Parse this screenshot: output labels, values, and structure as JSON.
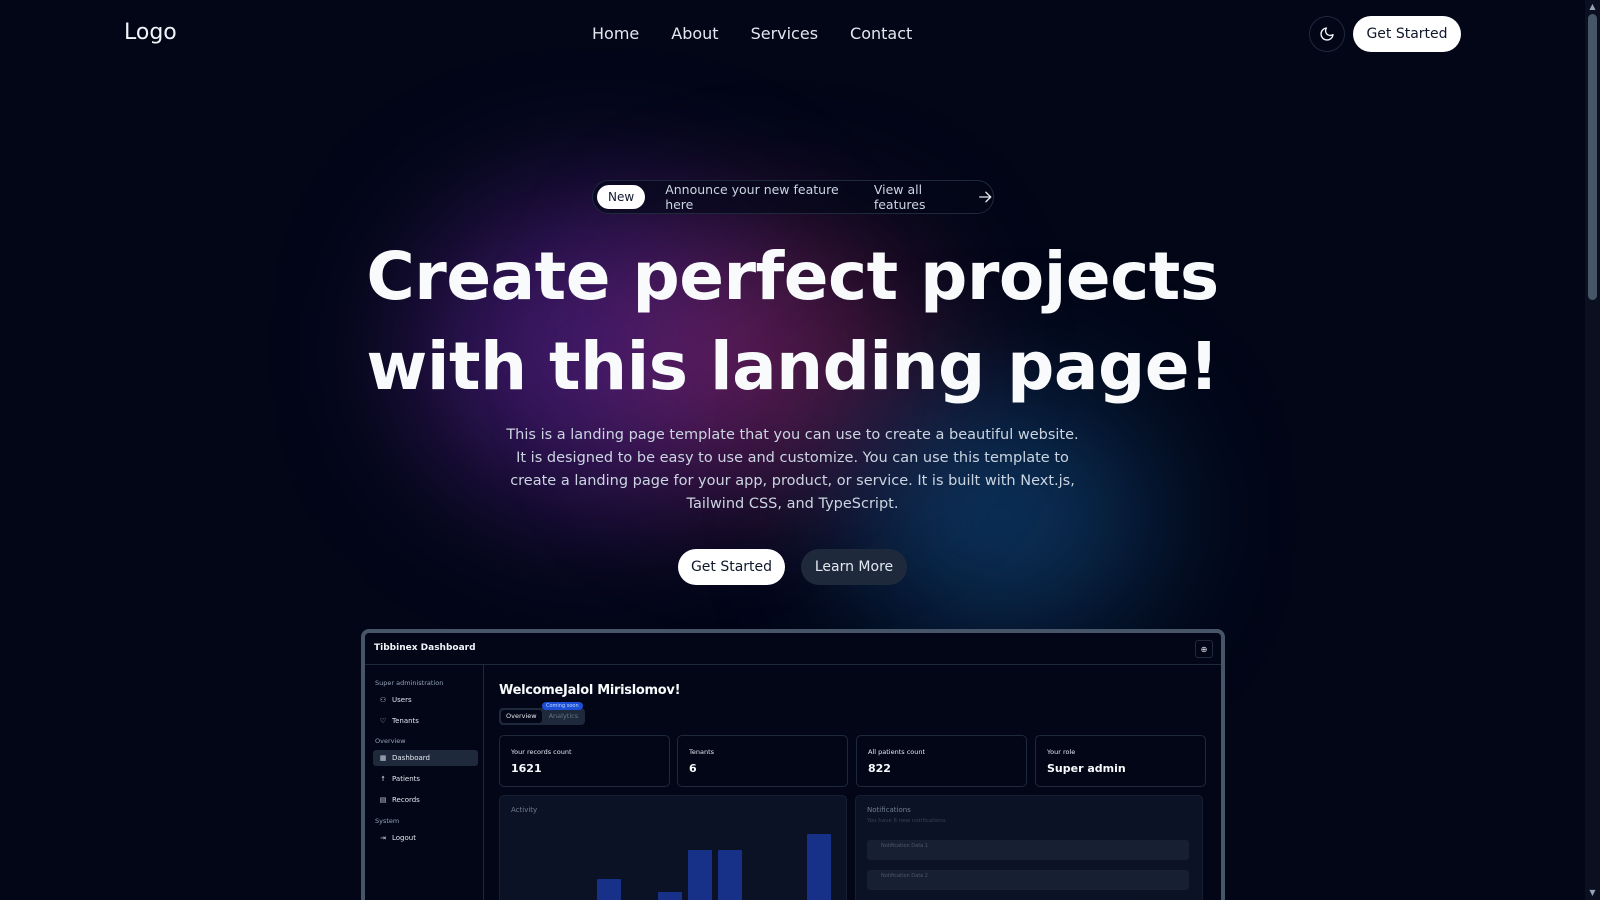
{
  "header": {
    "logo": "Logo",
    "nav": [
      "Home",
      "About",
      "Services",
      "Contact"
    ],
    "cta": "Get Started",
    "theme_icon": "moon-icon"
  },
  "announcement": {
    "badge": "New",
    "text": "Announce your new feature here",
    "link": "View all features",
    "link_icon": "arrow-right-icon"
  },
  "hero": {
    "title_line1": "Create perfect projects",
    "title_line2": "with this landing page!",
    "subtitle": "This is a landing page template that you can use to create a beautiful website. It is designed to be easy to use and customize. You can use this template to create a landing page for your app, product, or service. It is built with Next.js, Tailwind CSS, and TypeScript.",
    "primary_button": "Get Started",
    "secondary_button": "Learn More"
  },
  "dashboard": {
    "title": "Tibbinex Dashboard",
    "sidebar": {
      "groups": [
        {
          "label": "Super administration",
          "items": [
            {
              "label": "Users",
              "icon": "users-icon"
            },
            {
              "label": "Tenants",
              "icon": "shield-icon"
            }
          ]
        },
        {
          "label": "Overview",
          "items": [
            {
              "label": "Dashboard",
              "icon": "grid-icon",
              "active": true
            },
            {
              "label": "Patients",
              "icon": "person-icon"
            },
            {
              "label": "Records",
              "icon": "document-icon"
            }
          ]
        },
        {
          "label": "System",
          "items": [
            {
              "label": "Logout",
              "icon": "logout-icon"
            }
          ]
        }
      ]
    },
    "welcome": "WelcomeJalol Mirislomov!",
    "tabs": [
      "Overview",
      "Analytics"
    ],
    "coming_soon": "Coming soon",
    "stats": [
      {
        "label": "Your records count",
        "value": "1621"
      },
      {
        "label": "Tenants",
        "value": "6"
      },
      {
        "label": "All patients count",
        "value": "822"
      },
      {
        "label": "Your role",
        "value": "Super admin"
      }
    ],
    "activity": {
      "title": "Activity"
    },
    "notifications": {
      "title": "Notifications",
      "subtitle": "You have 6 new notifications",
      "items": [
        "Notification Data 1",
        "Notification Data 2"
      ]
    }
  },
  "colors": {
    "background": "#020617",
    "accent_blue": "#1e40af",
    "glow_purple": "#6e28aa",
    "glow_blue": "#145a96"
  }
}
